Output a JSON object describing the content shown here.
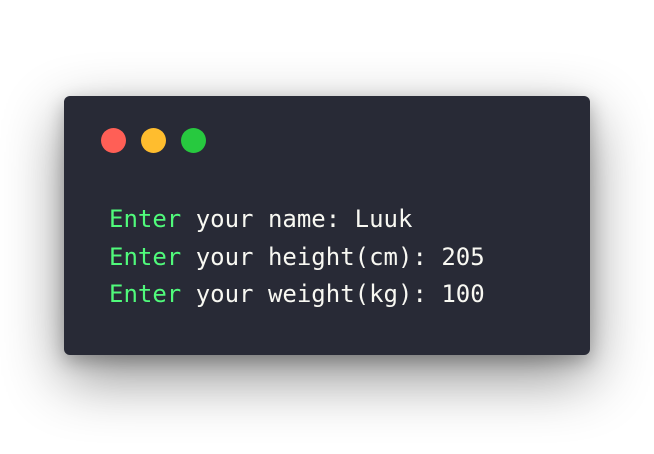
{
  "window": {
    "controls": {
      "close_color": "#ff5f56",
      "minimize_color": "#ffbd2e",
      "zoom_color": "#27c93f"
    }
  },
  "terminal": {
    "lines": [
      {
        "keyword": "Enter",
        "text": " your name: Luuk"
      },
      {
        "keyword": "Enter",
        "text": " your height(cm): 205"
      },
      {
        "keyword": "Enter",
        "text": " your weight(kg): 100"
      }
    ],
    "colors": {
      "background": "#282a36",
      "keyword": "#50fa7b",
      "text": "#f8f8f2"
    }
  }
}
